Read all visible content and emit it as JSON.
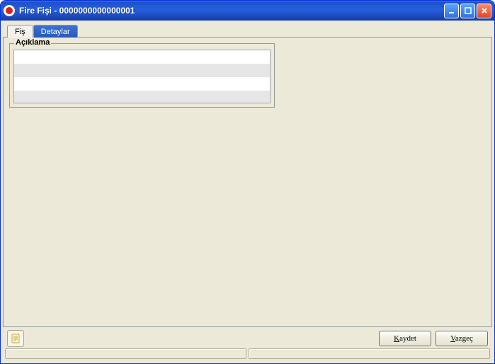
{
  "window": {
    "title": "Fire Fişi - 0000000000000001"
  },
  "tabs": {
    "fis": {
      "label": "Fiş"
    },
    "detaylar": {
      "label": "Detaylar"
    }
  },
  "group": {
    "aciklama_label": "Açıklama",
    "aciklama_value": ""
  },
  "buttons": {
    "kaydet_prefix": "K",
    "kaydet_rest": "aydet",
    "vazgec_prefix": "V",
    "vazgec_rest": "azgeç"
  }
}
